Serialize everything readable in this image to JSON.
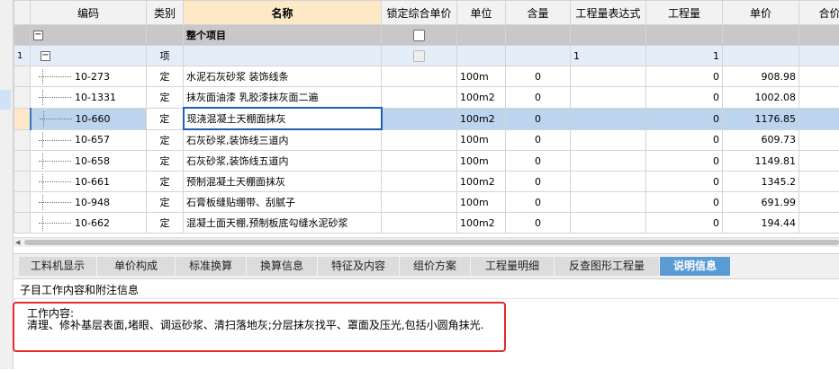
{
  "columns": {
    "code": "编码",
    "category": "类别",
    "name": "名称",
    "lock_price": "锁定综合单价",
    "unit": "单位",
    "content": "含量",
    "qty_expr": "工程量表达式",
    "qty": "工程量",
    "unit_price": "单价",
    "total": "合价"
  },
  "group_row": {
    "expander": "−",
    "name": "整个项目"
  },
  "item_row": {
    "row_number": "1",
    "expander": "−",
    "category": "项",
    "qty_expr": "1",
    "qty": "1"
  },
  "rows": [
    {
      "code": "10-273",
      "category": "定",
      "name": "水泥石灰砂浆 装饰线条",
      "unit": "100m",
      "content": "0",
      "qty": "0",
      "unit_price": "908.98"
    },
    {
      "code": "10-1331",
      "category": "定",
      "name": "抹灰面油漆 乳胶漆抹灰面二遍",
      "unit": "100m2",
      "content": "0",
      "qty": "0",
      "unit_price": "1002.08"
    },
    {
      "code": "10-660",
      "category": "定",
      "name": "现浇混凝土天棚面抹灰",
      "unit": "100m2",
      "content": "0",
      "qty": "0",
      "unit_price": "1176.85"
    },
    {
      "code": "10-657",
      "category": "定",
      "name": "石灰砂浆,装饰线三道内",
      "unit": "100m",
      "content": "0",
      "qty": "0",
      "unit_price": "609.73"
    },
    {
      "code": "10-658",
      "category": "定",
      "name": "石灰砂浆,装饰线五道内",
      "unit": "100m",
      "content": "0",
      "qty": "0",
      "unit_price": "1149.81"
    },
    {
      "code": "10-661",
      "category": "定",
      "name": "预制混凝土天棚面抹灰",
      "unit": "100m2",
      "content": "0",
      "qty": "0",
      "unit_price": "1345.2"
    },
    {
      "code": "10-948",
      "category": "定",
      "name": "石膏板缝贴绷带、刮腻子",
      "unit": "100m",
      "content": "0",
      "qty": "0",
      "unit_price": "691.99"
    },
    {
      "code": "10-662",
      "category": "定",
      "name": "混凝土面天棚,预制板底勾缝水泥砂浆",
      "unit": "100m2",
      "content": "0",
      "qty": "0",
      "unit_price": "194.44"
    }
  ],
  "tabs": [
    "工料机显示",
    "单价构成",
    "标准换算",
    "换算信息",
    "特征及内容",
    "组价方案",
    "工程量明细",
    "反查图形工程量",
    "说明信息"
  ],
  "active_tab": "说明信息",
  "section_title": "子目工作内容和附注信息",
  "description": {
    "label": "工作内容:",
    "text": "清理、修补基层表面,堵眼、调运砂浆、清扫落地灰;分层抹灰找平、罩面及压光,包括小圆角抹光."
  },
  "colors": {
    "header_highlight": "#fde9c8",
    "group_row": "#c8c8c8",
    "item_row": "#e4eef9",
    "selected_row": "#bcd4ee",
    "active_tab": "#5b9bd5",
    "highlight_frame": "#e52b2b"
  }
}
